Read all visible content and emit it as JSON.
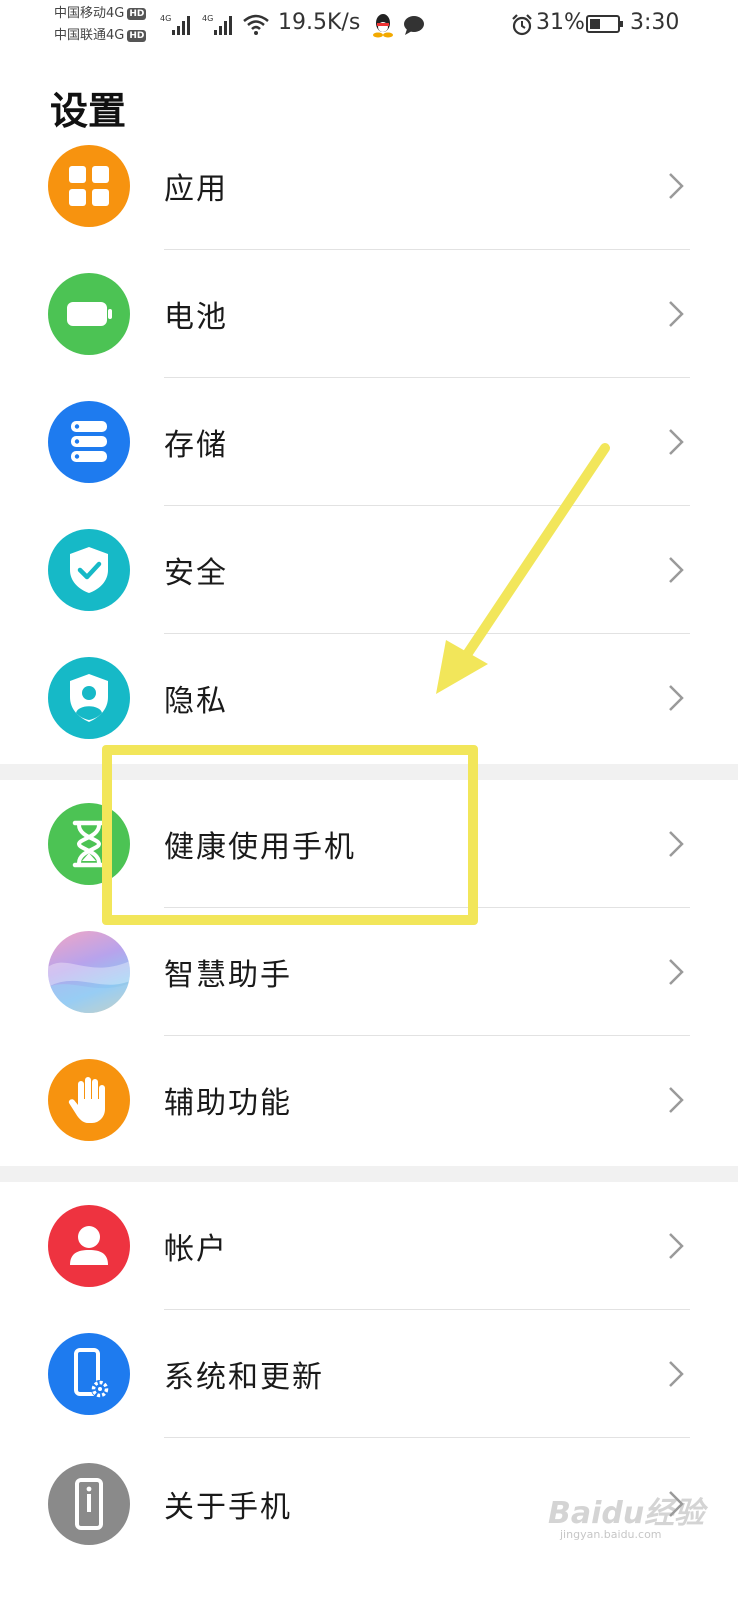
{
  "status_bar": {
    "carrier1": "中国移动4G",
    "carrier2": "中国联通4G",
    "hd_badge": "HD",
    "network_tag": "4G",
    "speed": "19.5K/s",
    "battery": "31%",
    "time": "3:30",
    "icons": [
      "signal-icon",
      "wifi-icon",
      "qq-icon",
      "message-icon",
      "alarm-icon",
      "battery-icon"
    ]
  },
  "page": {
    "title": "设置"
  },
  "sections": [
    {
      "items": [
        {
          "label": "应用",
          "icon": "apps-icon",
          "color": "#F7930F"
        },
        {
          "label": "电池",
          "icon": "battery-icon",
          "color": "#4CC354"
        },
        {
          "label": "存储",
          "icon": "storage-icon",
          "color": "#1E7BEF"
        },
        {
          "label": "安全",
          "icon": "security-shield-icon",
          "color": "#16B9C7"
        },
        {
          "label": "隐私",
          "icon": "privacy-icon",
          "color": "#16B9C7"
        }
      ]
    },
    {
      "items": [
        {
          "label": "健康使用手机",
          "icon": "hourglass-icon",
          "color": "#4CC354"
        },
        {
          "label": "智慧助手",
          "icon": "smart-assistant-icon",
          "color": "gradient"
        },
        {
          "label": "辅助功能",
          "icon": "hand-icon",
          "color": "#F7930F"
        }
      ]
    },
    {
      "items": [
        {
          "label": "帐户",
          "icon": "account-icon",
          "color": "#EE3340"
        },
        {
          "label": "系统和更新",
          "icon": "system-update-icon",
          "color": "#1E7BEF"
        },
        {
          "label": "关于手机",
          "icon": "about-phone-icon",
          "color": "#8A8A8A"
        }
      ]
    }
  ],
  "watermark": {
    "text": "Baidu经验",
    "sub": "jingyan.baidu.com"
  },
  "annotation": {
    "highlight_color": "#F2E65A"
  }
}
